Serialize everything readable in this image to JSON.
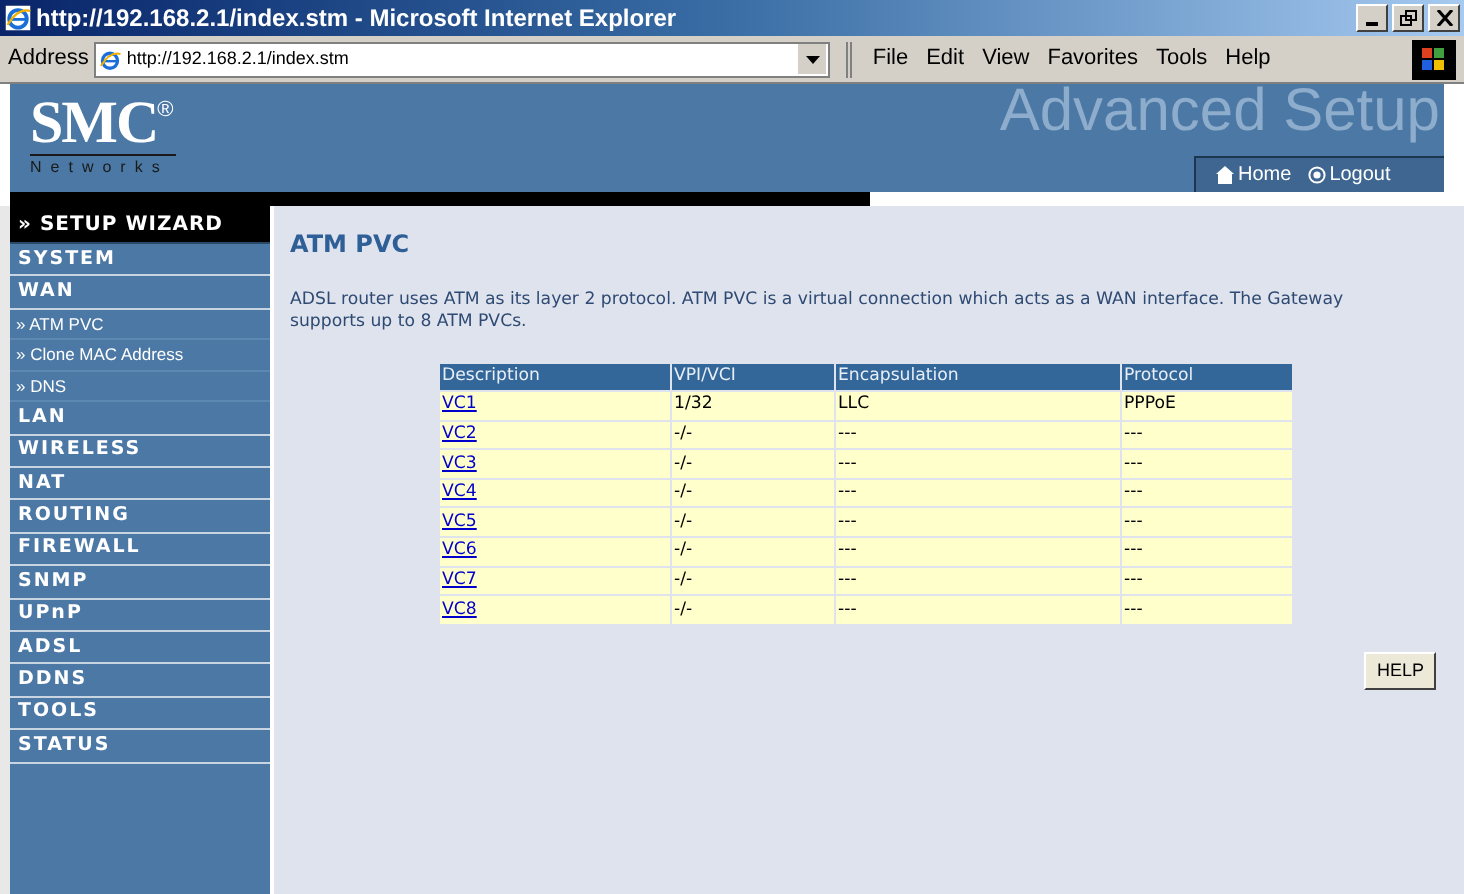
{
  "window": {
    "title": "http://192.168.2.1/index.stm - Microsoft Internet Explorer"
  },
  "address_bar": {
    "label": "Address",
    "url": "http://192.168.2.1/index.stm"
  },
  "menu": [
    "File",
    "Edit",
    "View",
    "Favorites",
    "Tools",
    "Help"
  ],
  "header": {
    "logo": "SMC",
    "logo_mark": "®",
    "logo_sub": "Networks",
    "banner": "Advanced Setup",
    "links": [
      "Home",
      "Logout"
    ]
  },
  "sidebar": {
    "items": [
      {
        "kind": "wizard",
        "label": "» SETUP WIZARD"
      },
      {
        "kind": "section",
        "label": "SYSTEM"
      },
      {
        "kind": "section",
        "label": "WAN",
        "children": [
          {
            "label": "» ATM PVC"
          },
          {
            "label": "» Clone MAC Address"
          },
          {
            "label": "» DNS"
          }
        ]
      },
      {
        "kind": "section",
        "label": "LAN"
      },
      {
        "kind": "section",
        "label": "WIRELESS"
      },
      {
        "kind": "section",
        "label": "NAT"
      },
      {
        "kind": "section",
        "label": "ROUTING"
      },
      {
        "kind": "section",
        "label": "FIREWALL"
      },
      {
        "kind": "section",
        "label": "SNMP"
      },
      {
        "kind": "section",
        "label": "UPnP"
      },
      {
        "kind": "section",
        "label": "ADSL"
      },
      {
        "kind": "section",
        "label": "DDNS"
      },
      {
        "kind": "section",
        "label": "TOOLS"
      },
      {
        "kind": "section",
        "label": "STATUS"
      }
    ]
  },
  "main": {
    "heading": "ATM PVC",
    "description": "ADSL router uses ATM as its layer 2 protocol. ATM PVC is a virtual connection which acts as a WAN interface. The Gateway supports up to 8 ATM PVCs.",
    "table": {
      "columns": [
        "Description",
        "VPI/VCI",
        "Encapsulation",
        "Protocol"
      ],
      "rows": [
        [
          "VC1",
          "1/32",
          "LLC",
          "PPPoE"
        ],
        [
          "VC2",
          "-/-",
          "---",
          "---"
        ],
        [
          "VC3",
          "-/-",
          "---",
          "---"
        ],
        [
          "VC4",
          "-/-",
          "---",
          "---"
        ],
        [
          "VC5",
          "-/-",
          "---",
          "---"
        ],
        [
          "VC6",
          "-/-",
          "---",
          "---"
        ],
        [
          "VC7",
          "-/-",
          "---",
          "---"
        ],
        [
          "VC8",
          "-/-",
          "---",
          "---"
        ]
      ]
    },
    "help_button": "HELP"
  }
}
